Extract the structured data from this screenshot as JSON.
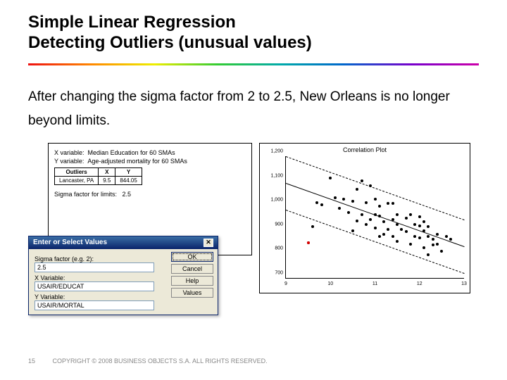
{
  "title_line1": "Simple Linear Regression",
  "title_line2": "Detecting Outliers (unusual values)",
  "body_text": "After changing the sigma factor from 2 to 2.5, New Orleans is no longer beyond limits.",
  "left_panel": {
    "xvar_label": "X variable:",
    "xvar_value": "Median Education for 60 SMAs",
    "yvar_label": "Y variable:",
    "yvar_value": "Age-adjusted mortality for 60 SMAs",
    "outliers_header_0": "Outliers",
    "outliers_header_1": "X",
    "outliers_header_2": "Y",
    "outlier_row_name": "Lancaster, PA",
    "outlier_row_x": "9.5",
    "outlier_row_y": "844.05",
    "sigma_label": "Sigma factor for limits:",
    "sigma_value": "2.5"
  },
  "dialog": {
    "title": "Enter or Select Values",
    "field1_label": "Sigma factor (e.g. 2):",
    "field1_value": "2.5",
    "field2_label": "X Variable:",
    "field2_value": "USAIR/EDUCAT",
    "field3_label": "Y Variable:",
    "field3_value": "USAIR/MORTAL",
    "btn_ok": "OK",
    "btn_cancel": "Cancel",
    "btn_help": "Help",
    "btn_values": "Values"
  },
  "footer": {
    "page": "15",
    "copyright": "COPYRIGHT © 2008 BUSINESS OBJECTS S.A.  ALL RIGHTS RESERVED."
  },
  "chart_data": {
    "type": "scatter",
    "title": "Correlation Plot",
    "xlabel": "",
    "ylabel": "",
    "xlim": [
      9,
      13
    ],
    "ylim": [
      700,
      1200
    ],
    "xticks": [
      9,
      10,
      11,
      12,
      13
    ],
    "yticks": [
      700,
      800,
      900,
      1000,
      1100,
      1200
    ],
    "regression": {
      "x1": 9,
      "y1": 1090,
      "x2": 13,
      "y2": 830
    },
    "upper_band": {
      "x1": 9,
      "y1": 1200,
      "x2": 13,
      "y2": 940
    },
    "lower_band": {
      "x1": 9,
      "y1": 980,
      "x2": 13,
      "y2": 720
    },
    "series": [
      {
        "name": "SMAs",
        "color": "#000",
        "points": [
          {
            "x": 9.5,
            "y": 844
          },
          {
            "x": 9.6,
            "y": 912
          },
          {
            "x": 9.7,
            "y": 1010
          },
          {
            "x": 9.8,
            "y": 1000
          },
          {
            "x": 10.0,
            "y": 1110
          },
          {
            "x": 10.1,
            "y": 1030
          },
          {
            "x": 10.2,
            "y": 985
          },
          {
            "x": 10.3,
            "y": 1025
          },
          {
            "x": 10.4,
            "y": 970
          },
          {
            "x": 10.5,
            "y": 895
          },
          {
            "x": 10.5,
            "y": 1015
          },
          {
            "x": 10.6,
            "y": 1065
          },
          {
            "x": 10.6,
            "y": 935
          },
          {
            "x": 10.7,
            "y": 1100
          },
          {
            "x": 10.7,
            "y": 960
          },
          {
            "x": 10.8,
            "y": 920
          },
          {
            "x": 10.8,
            "y": 1010
          },
          {
            "x": 10.9,
            "y": 1080
          },
          {
            "x": 10.9,
            "y": 940
          },
          {
            "x": 11.0,
            "y": 960
          },
          {
            "x": 11.0,
            "y": 905
          },
          {
            "x": 11.0,
            "y": 1025
          },
          {
            "x": 11.1,
            "y": 870
          },
          {
            "x": 11.1,
            "y": 955
          },
          {
            "x": 11.1,
            "y": 995
          },
          {
            "x": 11.2,
            "y": 930
          },
          {
            "x": 11.2,
            "y": 880
          },
          {
            "x": 11.3,
            "y": 1005
          },
          {
            "x": 11.3,
            "y": 900
          },
          {
            "x": 11.4,
            "y": 940
          },
          {
            "x": 11.4,
            "y": 870
          },
          {
            "x": 11.4,
            "y": 1005
          },
          {
            "x": 11.5,
            "y": 920
          },
          {
            "x": 11.5,
            "y": 960
          },
          {
            "x": 11.5,
            "y": 850
          },
          {
            "x": 11.6,
            "y": 900
          },
          {
            "x": 11.7,
            "y": 945
          },
          {
            "x": 11.7,
            "y": 890
          },
          {
            "x": 11.8,
            "y": 960
          },
          {
            "x": 11.8,
            "y": 840
          },
          {
            "x": 11.9,
            "y": 920
          },
          {
            "x": 11.9,
            "y": 870
          },
          {
            "x": 12.0,
            "y": 915
          },
          {
            "x": 12.0,
            "y": 865
          },
          {
            "x": 12.0,
            "y": 950
          },
          {
            "x": 12.1,
            "y": 825
          },
          {
            "x": 12.1,
            "y": 930
          },
          {
            "x": 12.1,
            "y": 895
          },
          {
            "x": 12.2,
            "y": 870
          },
          {
            "x": 12.2,
            "y": 910
          },
          {
            "x": 12.2,
            "y": 795
          },
          {
            "x": 12.3,
            "y": 860
          },
          {
            "x": 12.3,
            "y": 835
          },
          {
            "x": 12.4,
            "y": 880
          },
          {
            "x": 12.4,
            "y": 840
          },
          {
            "x": 12.5,
            "y": 810
          },
          {
            "x": 12.6,
            "y": 870
          },
          {
            "x": 12.7,
            "y": 860
          }
        ]
      },
      {
        "name": "outlier",
        "color": "#d00",
        "points": [
          {
            "x": 9.5,
            "y": 844
          }
        ]
      }
    ]
  }
}
